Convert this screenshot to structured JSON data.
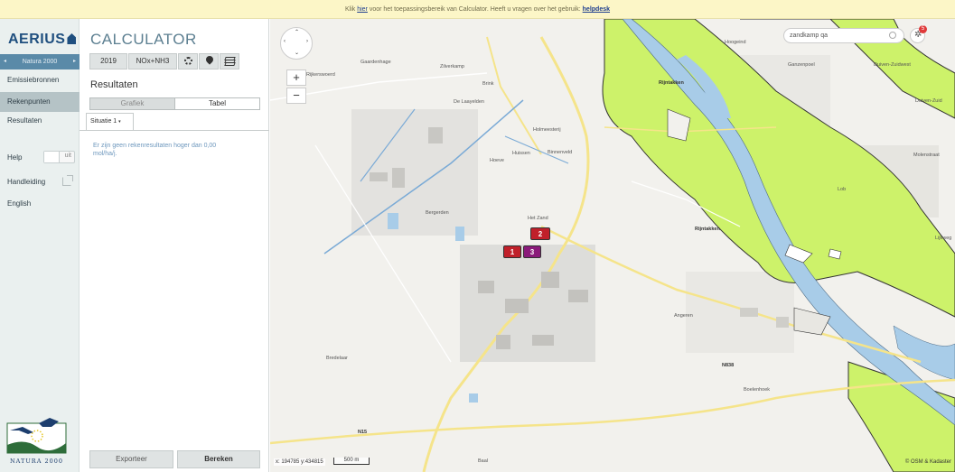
{
  "banner": {
    "prefix": "Klik ",
    "link_here": "hier",
    "middle": " voor het toepassingsbereik van Calculator. Heeft u vragen over het gebruik: ",
    "link_helpdesk": "helpdesk"
  },
  "sidebar": {
    "logo": "AERIUS",
    "area_nav": "Natura 2000",
    "items": [
      {
        "label": "Emissiebronnen"
      },
      {
        "label": "Rekenpunten"
      },
      {
        "label": "Resultaten"
      }
    ],
    "help_label": "Help",
    "help_toggle": "uit",
    "manual_label": "Handleiding",
    "language_label": "English",
    "natura_logo_text": "NATURA 2000"
  },
  "panel": {
    "title": "CALCULATOR",
    "year": "2019",
    "substance": "NOx+NH3",
    "results_title": "Resultaten",
    "seg_graph": "Grafiek",
    "seg_table": "Tabel",
    "situation_tab": "Situatie 1",
    "no_results": "Er zijn geen rekenresultaten hoger dan 0,00 mol/ha/j.",
    "export_button": "Exporteer",
    "calculate_button": "Bereken"
  },
  "map": {
    "search_value": "zandkamp qa",
    "notification_count": "5",
    "coordinates": "x: 194785 y:434815",
    "scale": "500 m",
    "attribution": "© OSM & Kadaster",
    "markers": [
      {
        "label": "2",
        "color": "#c0202a"
      },
      {
        "label": "1",
        "color": "#c0202a"
      },
      {
        "label": "3",
        "color": "#8a1a7a"
      }
    ],
    "place_labels": [
      "Hoogeind",
      "Ganzenpoel",
      "Duiven-Zuidwest",
      "Duiven-Zuid",
      "Rijntakken",
      "Gaardenhage",
      "Rijkerswoerd",
      "Zilverkamp",
      "Brink",
      "De Laayelden",
      "Holmeesterij",
      "Huissen",
      "Binnenveld",
      "Hoeve",
      "Bergerden",
      "Het Zand",
      "Angeren",
      "Lob",
      "Bredelaar",
      "Boelenhoek",
      "Baal",
      "N838",
      "N15",
      "Lijkweg",
      "Molenstraat",
      "Rijntakken"
    ]
  },
  "colors": {
    "natura": "#cdf26a",
    "river": "#a8cce8",
    "accent": "#5c7f91"
  }
}
